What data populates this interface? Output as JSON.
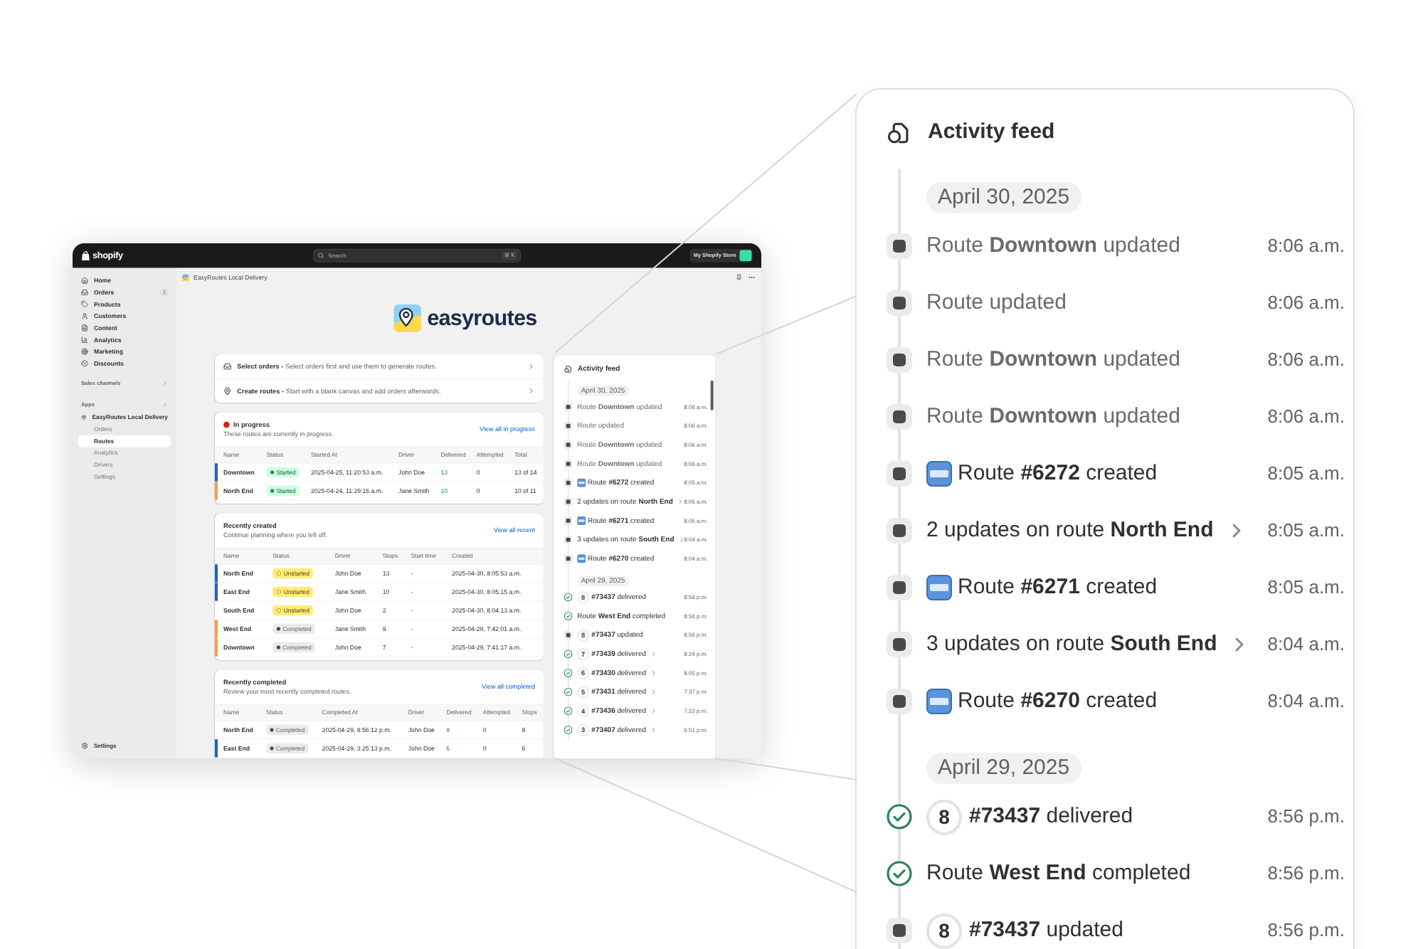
{
  "app_window": {
    "top_bar": {
      "logo_text": "shopify",
      "search": {
        "placeholder": "Search",
        "shortcut": "⌘ K"
      },
      "store": {
        "name": "My Shopify Store"
      }
    },
    "sidebar": {
      "items": [
        {
          "label": "Home",
          "selected": false
        },
        {
          "label": "Orders",
          "badge": "2",
          "selected": false
        },
        {
          "label": "Products",
          "selected": false
        },
        {
          "label": "Customers",
          "selected": false
        },
        {
          "label": "Content",
          "selected": false
        },
        {
          "label": "Analytics",
          "selected": false
        },
        {
          "label": "Marketing",
          "selected": false
        },
        {
          "label": "Discounts",
          "selected": false
        }
      ],
      "sales_channels": {
        "label": "Sales channels"
      },
      "apps": {
        "label": "Apps",
        "app": {
          "label": "EasyRoutes Local Delivery",
          "children": [
            {
              "label": "Orders",
              "selected": false
            },
            {
              "label": "Routes",
              "selected": true
            },
            {
              "label": "Analytics",
              "selected": false
            },
            {
              "label": "Drivers",
              "selected": false
            },
            {
              "label": "Settings",
              "selected": false
            }
          ]
        }
      },
      "settings": {
        "label": "Settings"
      }
    },
    "header": {
      "title": "EasyRoutes Local Delivery"
    },
    "logo": {
      "text": "easyroutes"
    },
    "actions": [
      {
        "text": "**Select orders -** Select orders first and use them to generate routes."
      },
      {
        "text": "**Create routes -** Start with a blank canvas and add orders afterwards."
      }
    ],
    "cards": [
      {
        "title": "In progress",
        "color": "#e51c00",
        "subtitle": "These routes are currently in progress.",
        "link": "View all in progress",
        "columns": [
          {
            "label": "Name",
            "kind": "name"
          },
          {
            "label": "Status",
            "kind": "status"
          },
          {
            "label": "Started At",
            "kind": "text"
          },
          {
            "label": "Driver",
            "kind": "text"
          },
          {
            "label": "Delivered",
            "kind": "count"
          },
          {
            "label": "Attempted",
            "kind": "text"
          },
          {
            "label": "Total",
            "kind": "text"
          }
        ],
        "rows": [
          {
            "color": "#2463bc",
            "kind": "started",
            "cells": [
              "Downtown",
              "Started",
              "2025-04-25, 11:20:53 a.m.",
              "John Doe",
              "13",
              "0",
              "13 of 14"
            ]
          },
          {
            "color": "#f29e4c",
            "kind": "started",
            "cells": [
              "North End",
              "Started",
              "2025-04-24, 11:29:16 a.m.",
              "Jane Smith",
              "10",
              "0",
              "10 of 11"
            ]
          }
        ]
      },
      {
        "title": "Recently created",
        "subtitle": "Continue planning where you left off.",
        "link": "View all recent",
        "columns": [
          {
            "label": "Name",
            "kind": "name"
          },
          {
            "label": "Status",
            "kind": "status"
          },
          {
            "label": "Driver",
            "kind": "text"
          },
          {
            "label": "Stops",
            "kind": "text"
          },
          {
            "label": "Start time",
            "kind": "text"
          },
          {
            "label": "Created",
            "kind": "text"
          }
        ],
        "rows": [
          {
            "color": "#2463bc",
            "kind": "unstarted",
            "cells": [
              "North End",
              "Unstarted",
              "John Doe",
              "13",
              "-",
              "2025-04-30, 8:05:53 a.m."
            ]
          },
          {
            "color": "#2463bc",
            "kind": "unstarted",
            "cells": [
              "East End",
              "Unstarted",
              "Jane Smith",
              "10",
              "-",
              "2025-04-30, 8:05:15 a.m."
            ]
          },
          {
            "kind": "unstarted",
            "cells": [
              "South End",
              "Unstarted",
              "John Doe",
              "2",
              "-",
              "2025-04-30, 8:04:13 a.m."
            ]
          },
          {
            "color": "#f29e4c",
            "kind": "completed",
            "cells": [
              "West End",
              "Completed",
              "Jane Smith",
              "9",
              "-",
              "2025-04-29, 7:42:01 a.m."
            ]
          },
          {
            "color": "#f29e4c",
            "kind": "completed",
            "cells": [
              "Downtown",
              "Completed",
              "John Doe",
              "7",
              "-",
              "2025-04-29, 7:41:17 a.m."
            ]
          }
        ]
      },
      {
        "title": "Recently completed",
        "subtitle": "Review your most recently completed routes.",
        "link": "View all completed",
        "columns": [
          {
            "label": "Name",
            "kind": "name"
          },
          {
            "label": "Status",
            "kind": "status"
          },
          {
            "label": "Completed At",
            "kind": "text"
          },
          {
            "label": "Driver",
            "kind": "text"
          },
          {
            "label": "Delivered",
            "kind": "count"
          },
          {
            "label": "Attempted",
            "kind": "text"
          },
          {
            "label": "Stops",
            "kind": "text"
          }
        ],
        "rows": [
          {
            "kind": "completed",
            "cells": [
              "North End",
              "Completed",
              "2025-04-29, 8:56:12 p.m.",
              "John Doe",
              "8",
              "0",
              "8"
            ]
          },
          {
            "color": "#2463bc",
            "kind": "completed",
            "cells": [
              "East End",
              "Completed",
              "2025-04-29, 3:25:13 p.m.",
              "John Doe",
              "6",
              "0",
              "6"
            ]
          }
        ]
      }
    ],
    "activity_feed": {
      "title": "Activity feed",
      "groups": [
        {
          "date": "April 30, 2025",
          "items": [
            {
              "kind": "update",
              "muted": true,
              "is_new": false,
              "expandable": false,
              "text": "Route **Downtown** updated",
              "time": "8:06 a.m."
            },
            {
              "kind": "update",
              "muted": true,
              "is_new": false,
              "expandable": false,
              "text": "Route updated",
              "time": "8:06 a.m."
            },
            {
              "kind": "update",
              "muted": true,
              "is_new": false,
              "expandable": false,
              "text": "Route **Downtown** updated",
              "time": "8:06 a.m."
            },
            {
              "kind": "update",
              "muted": true,
              "is_new": false,
              "expandable": false,
              "text": "Route **Downtown** updated",
              "time": "8:06 a.m."
            },
            {
              "kind": "update",
              "muted": false,
              "is_new": true,
              "expandable": false,
              "text": "Route **#6272** created",
              "time": "8:05 a.m."
            },
            {
              "kind": "update",
              "muted": false,
              "is_new": false,
              "expandable": true,
              "text": "2 updates on route **North End**",
              "time": "8:05 a.m."
            },
            {
              "kind": "update",
              "muted": false,
              "is_new": true,
              "expandable": false,
              "text": "Route **#6271** created",
              "time": "8:05 a.m."
            },
            {
              "kind": "update",
              "muted": false,
              "is_new": false,
              "expandable": true,
              "text": "3 updates on route **South End**",
              "time": "8:04 a.m."
            },
            {
              "kind": "update",
              "muted": false,
              "is_new": true,
              "expandable": false,
              "text": "Route **#6270** created",
              "time": "8:04 a.m."
            }
          ]
        },
        {
          "date": "April 29, 2025",
          "items": [
            {
              "kind": "done",
              "muted": false,
              "is_new": false,
              "expandable": false,
              "stop": "8",
              "text": "**#73437** delivered",
              "time": "8:56 p.m."
            },
            {
              "kind": "done",
              "muted": false,
              "is_new": false,
              "expandable": false,
              "text": "Route **West End** completed",
              "time": "8:56 p.m."
            },
            {
              "kind": "update",
              "muted": false,
              "is_new": false,
              "expandable": false,
              "stop": "8",
              "text": "**#73437** updated",
              "time": "8:56 p.m."
            },
            {
              "kind": "done",
              "muted": false,
              "is_new": false,
              "expandable": true,
              "stop": "7",
              "text": "**#73439** delivered",
              "time": "8:24 p.m."
            },
            {
              "kind": "done",
              "muted": false,
              "is_new": false,
              "expandable": true,
              "stop": "6",
              "text": "**#73430** delivered",
              "time": "8:05 p.m."
            },
            {
              "kind": "done",
              "muted": false,
              "is_new": false,
              "expandable": true,
              "stop": "5",
              "text": "**#73431** delivered",
              "time": "7:37 p.m."
            },
            {
              "kind": "done",
              "muted": false,
              "is_new": false,
              "expandable": true,
              "stop": "4",
              "text": "**#73436** delivered",
              "time": "7:22 p.m."
            },
            {
              "kind": "done",
              "muted": false,
              "is_new": false,
              "expandable": true,
              "stop": "3",
              "text": "**#73407** delivered",
              "time": "6:51 p.m."
            }
          ]
        }
      ]
    }
  },
  "activity_feed": {
    "title": "Activity feed",
    "groups": [
      {
        "date": "April 30, 2025",
        "items": [
          {
            "kind": "update",
            "muted": true,
            "is_new": false,
            "expandable": false,
            "text": "Route **Downtown** updated",
            "time": "8:06 a.m."
          },
          {
            "kind": "update",
            "muted": true,
            "is_new": false,
            "expandable": false,
            "text": "Route updated",
            "time": "8:06 a.m."
          },
          {
            "kind": "update",
            "muted": true,
            "is_new": false,
            "expandable": false,
            "text": "Route **Downtown** updated",
            "time": "8:06 a.m."
          },
          {
            "kind": "update",
            "muted": true,
            "is_new": false,
            "expandable": false,
            "text": "Route **Downtown** updated",
            "time": "8:06 a.m."
          },
          {
            "kind": "update",
            "muted": false,
            "is_new": true,
            "expandable": false,
            "text": "Route **#6272** created",
            "time": "8:05 a.m."
          },
          {
            "kind": "update",
            "muted": false,
            "is_new": false,
            "expandable": true,
            "text": "2 updates on route **North End**",
            "time": "8:05 a.m."
          },
          {
            "kind": "update",
            "muted": false,
            "is_new": true,
            "expandable": false,
            "text": "Route **#6271** created",
            "time": "8:05 a.m."
          },
          {
            "kind": "update",
            "muted": false,
            "is_new": false,
            "expandable": true,
            "text": "3 updates on route **South End**",
            "time": "8:04 a.m."
          },
          {
            "kind": "update",
            "muted": false,
            "is_new": true,
            "expandable": false,
            "text": "Route **#6270** created",
            "time": "8:04 a.m."
          }
        ]
      },
      {
        "date": "April 29, 2025",
        "items": [
          {
            "kind": "done",
            "muted": false,
            "is_new": false,
            "expandable": false,
            "stop": "8",
            "text": "**#73437** delivered",
            "time": "8:56 p.m."
          },
          {
            "kind": "done",
            "muted": false,
            "is_new": false,
            "expandable": false,
            "text": "Route **West End** completed",
            "time": "8:56 p.m."
          },
          {
            "kind": "update",
            "muted": false,
            "is_new": false,
            "expandable": false,
            "stop": "8",
            "text": "**#73437** updated",
            "time": "8:56 p.m."
          }
        ]
      }
    ]
  }
}
